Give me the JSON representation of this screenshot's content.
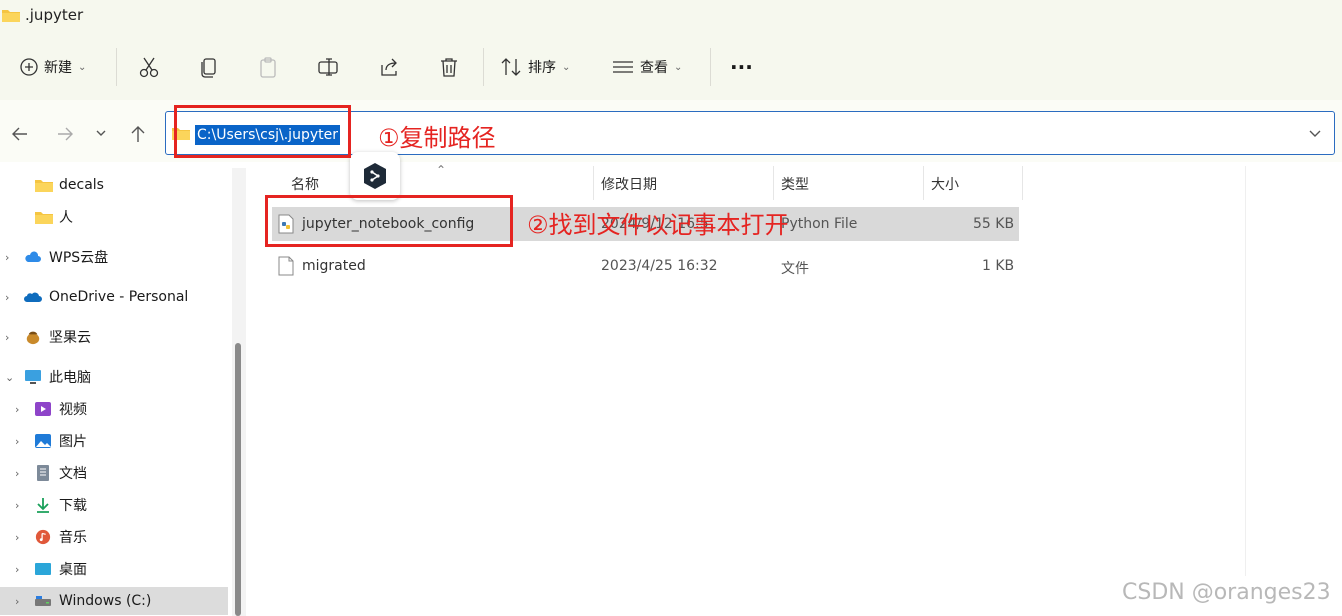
{
  "window": {
    "title": ".jupyter"
  },
  "toolbar": {
    "new_label": "新建",
    "sort_label": "排序",
    "view_label": "查看",
    "more_label": "···"
  },
  "address": {
    "path": "C:\\Users\\csj\\.jupyter"
  },
  "columns": {
    "name": "名称",
    "modified": "修改日期",
    "type": "类型",
    "size": "大小"
  },
  "files": [
    {
      "name": "jupyter_notebook_config",
      "modified": "2024/9/12 16:5",
      "type": "Python File",
      "size": "55 KB",
      "icon": "python-file-icon",
      "selected": true
    },
    {
      "name": "migrated",
      "modified": "2023/4/25 16:32",
      "type": "文件",
      "size": "1 KB",
      "icon": "file-icon",
      "selected": false
    }
  ],
  "sidebar": {
    "items": [
      {
        "label": "decals",
        "icon": "folder-icon"
      },
      {
        "label": "人",
        "icon": "folder-icon"
      },
      {
        "label": "WPS云盘",
        "icon": "cloud-icon"
      },
      {
        "label": "OneDrive - Personal",
        "icon": "onedrive-icon"
      },
      {
        "label": "坚果云",
        "icon": "nut-icon"
      },
      {
        "label": "此电脑",
        "icon": "computer-icon"
      },
      {
        "label": "视频",
        "icon": "video-icon"
      },
      {
        "label": "图片",
        "icon": "picture-icon"
      },
      {
        "label": "文档",
        "icon": "document-icon"
      },
      {
        "label": "下载",
        "icon": "download-icon"
      },
      {
        "label": "音乐",
        "icon": "music-icon"
      },
      {
        "label": "桌面",
        "icon": "desktop-icon"
      },
      {
        "label": "Windows (C:)",
        "icon": "drive-icon"
      }
    ]
  },
  "annotations": {
    "step1": "①复制路径",
    "step2": "②找到文件以记事本打开"
  },
  "watermark": "CSDN @oranges23",
  "colors": {
    "annotation": "#e52421",
    "selection": "#0a64c8",
    "background": "#f6f8ee"
  }
}
